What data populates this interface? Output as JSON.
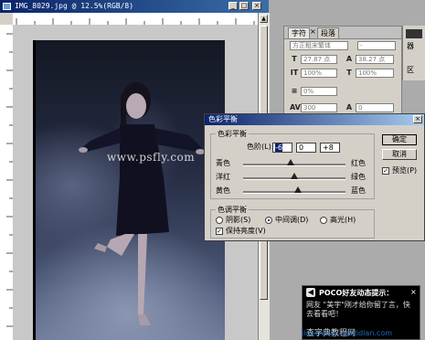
{
  "document": {
    "title": "IMG_8029.jpg @ 12.5%(RGB/8)",
    "watermark": "www.psfly.com"
  },
  "character_panel": {
    "tabs": [
      "字符",
      "段落"
    ],
    "font_family": "方正粗宋繁体",
    "font_style": "-",
    "font_size": "27.87 点",
    "leading": "38.27 点",
    "vertical_scale": "100%",
    "horizontal_scale": "100%",
    "tracking_pct": "0%",
    "tracking": "300",
    "kerning": "0",
    "side_labels": [
      "器",
      "区"
    ]
  },
  "color_balance": {
    "title": "色彩平衡",
    "group1_label": "色彩平衡",
    "levels_label": "色阶(L):",
    "levels": [
      "-6",
      "0",
      "+8"
    ],
    "sliders": [
      {
        "left": "青色",
        "right": "红色",
        "value": -6
      },
      {
        "left": "洋红",
        "right": "绿色",
        "value": 0
      },
      {
        "left": "黄色",
        "right": "蓝色",
        "value": 8
      }
    ],
    "group2_label": "色调平衡",
    "tone_options": [
      "阴影(S)",
      "中间调(D)",
      "高光(H)"
    ],
    "tone_selected": 1,
    "preserve_luminosity": "保持亮度(V)",
    "preserve_checked": true,
    "ok_label": "确定",
    "cancel_label": "取消",
    "preview_label": "预览(P)",
    "preview_checked": true
  },
  "tip": {
    "title": "POCO好友动态提示：",
    "text": "网友 \"美宇\"刚才给你留了言，快去看看吧！",
    "site": "查字典教程网",
    "site_url": "jiaocheng.chazidian.com"
  }
}
